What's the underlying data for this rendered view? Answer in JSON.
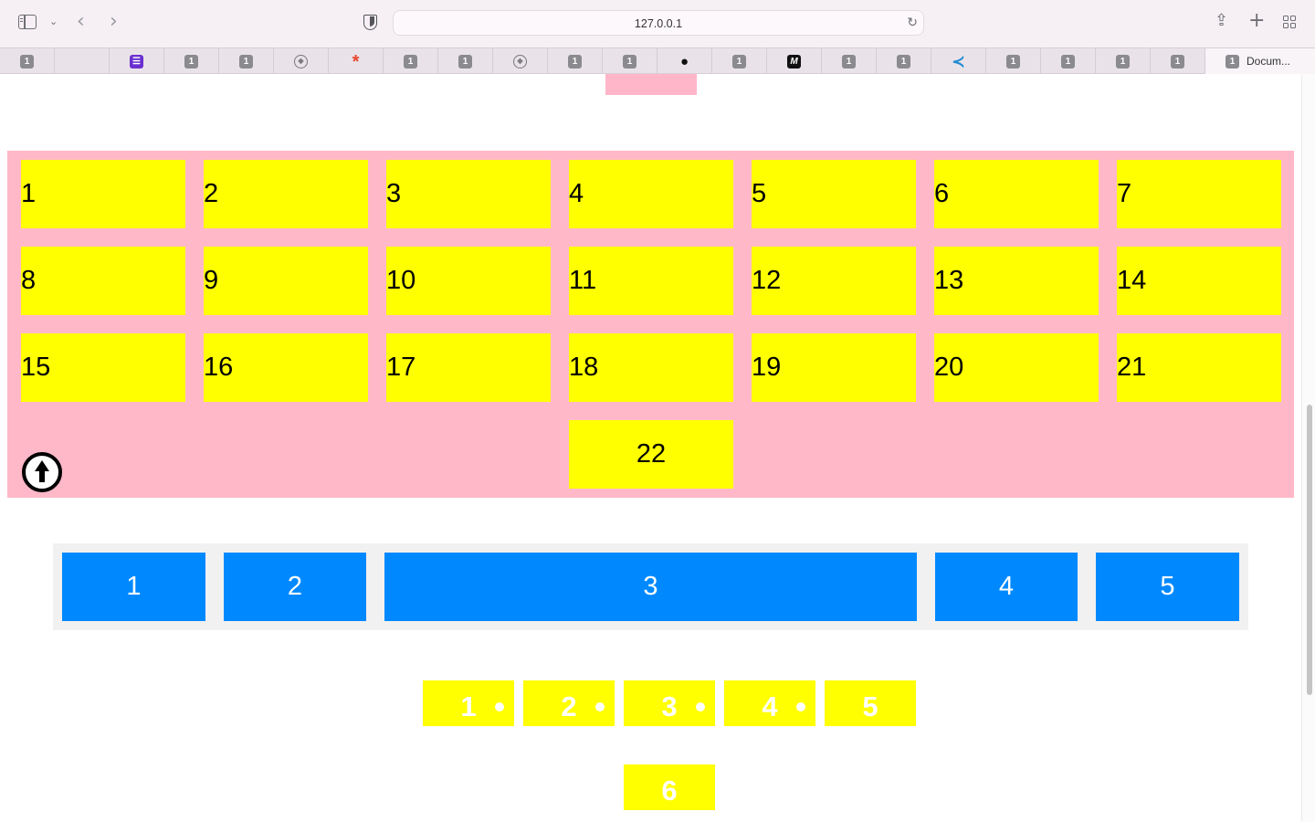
{
  "browser": {
    "url": "127.0.0.1",
    "active_tab_label": "Docum...",
    "tab_badge": "1"
  },
  "grid": {
    "items": [
      "1",
      "2",
      "3",
      "4",
      "5",
      "6",
      "7",
      "8",
      "9",
      "10",
      "11",
      "12",
      "13",
      "14",
      "15",
      "16",
      "17",
      "18",
      "19",
      "20",
      "21",
      "22"
    ]
  },
  "flex": {
    "items": [
      "1",
      "2",
      "3",
      "4",
      "5"
    ]
  },
  "yellow_row": {
    "items": [
      "1",
      "2",
      "3",
      "4",
      "5"
    ],
    "extra": "6"
  },
  "colors": {
    "pink": "#ffb8c8",
    "yellow": "#ffff00",
    "blue": "#0089ff",
    "light_gray": "#f1f1f1"
  }
}
